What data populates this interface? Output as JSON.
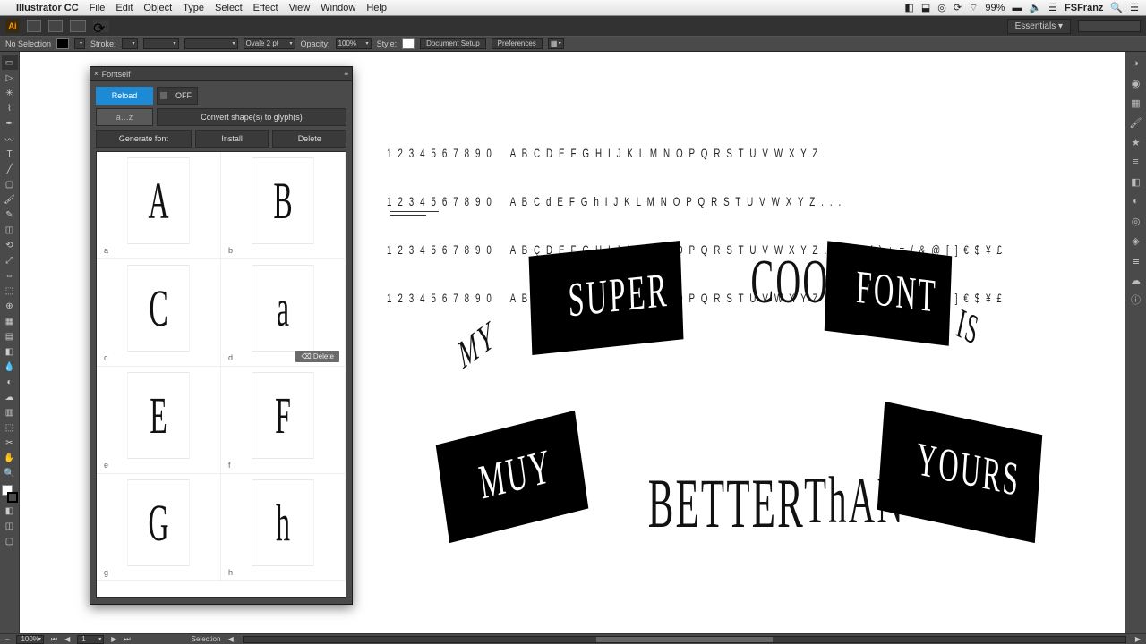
{
  "mac_menu": {
    "app": "Illustrator CC",
    "items": [
      "File",
      "Edit",
      "Object",
      "Type",
      "Select",
      "Effect",
      "View",
      "Window",
      "Help"
    ],
    "status_wifi": "99%",
    "user": "FSFranz"
  },
  "app_bar": {
    "workspace": "Essentials ▾"
  },
  "control": {
    "selection_label": "No Selection",
    "stroke_label": "Stroke:",
    "stroke_preset": "Ovale 2 pt",
    "opacity_label": "Opacity:",
    "opacity_value": "100%",
    "style_label": "Style:",
    "doc_setup": "Document Setup",
    "prefs": "Preferences"
  },
  "fontself": {
    "title": "Fontself",
    "reload": "Reload",
    "toggle": "OFF",
    "range_label": "a…z",
    "convert": "Convert shape(s) to glyph(s)",
    "generate": "Generate font",
    "install": "Install",
    "delete": "Delete",
    "glyphs": [
      {
        "char": "A",
        "label": "a"
      },
      {
        "char": "B",
        "label": "b"
      },
      {
        "char": "C",
        "label": "c"
      },
      {
        "char": "a",
        "label": "d",
        "showDelete": true
      },
      {
        "char": "E",
        "label": "e"
      },
      {
        "char": "F",
        "label": "f"
      },
      {
        "char": "G",
        "label": "g"
      },
      {
        "char": "h",
        "label": "h"
      }
    ],
    "row_delete": "⌫ Delete"
  },
  "artboard": {
    "row1": "1 2 3 4 5 6 7 8 9 0    A B C D E F G H I J K L M N O P Q R S T U V W X Y Z",
    "row2": "1 2 3 4 5 6 7 8 9 0    A B C d E F G h I J K L M N O P Q R S T U V W X Y Z . . .",
    "row3": "1 2 3 4 5 6 7 8 9 0    A B Ç D E F G H I J K L M N O P Q R S T U V W X Y Z . . . ! ? ( ) + = / & @ [ ] € $ ¥ £",
    "row4": "1 2 3 4 5 6 7 8 9 0    A B Ç D E F G H I J K L M N O P Q R S T U V W X Y Z . . . ! ? ( ) + = / & @ [ ] € $ ¥ £",
    "slogan": {
      "my": "MY",
      "super": "SUPER",
      "cool": "COOL",
      "font": "FONT",
      "is": "IS",
      "muy": "MUY",
      "better": "BETTER",
      "than": "ThAN",
      "yours": "YOURS"
    }
  },
  "status": {
    "zoom": "100%",
    "artboard_nav": "1",
    "mode": "Selection"
  }
}
